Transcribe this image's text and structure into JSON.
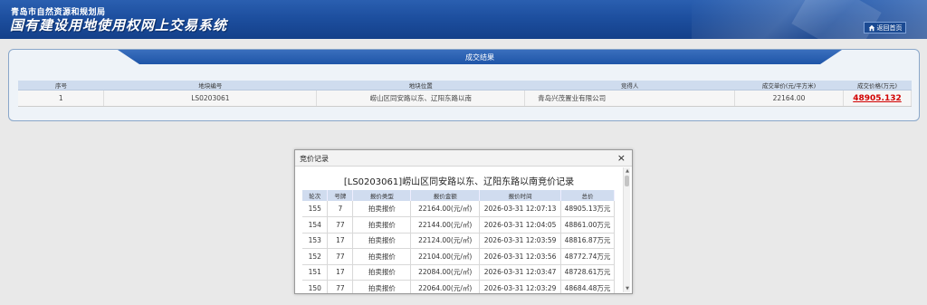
{
  "header": {
    "org_name": "青岛市自然资源和规划局",
    "system_title": "国有建设用地使用权网上交易系统",
    "back_label": "返回首页"
  },
  "result_panel": {
    "title": "成交结果",
    "columns": [
      "序号",
      "地块编号",
      "地块位置",
      "竞得人",
      "成交单价(元/平方米)",
      "成交价格(万元)"
    ],
    "row": {
      "index": "1",
      "parcel_no": "LS0203061",
      "location": "崂山区同安路以东、辽阳东路以南",
      "winner": "青岛兴茂置业有限公司",
      "unit_price": "22164.00",
      "total_price": "48905.132"
    }
  },
  "bid_dialog": {
    "title": "竞价记录",
    "close_symbol": "×",
    "heading": "[LS0203061]崂山区同安路以东、辽阳东路以南竞价记录",
    "columns": [
      "轮次",
      "号牌",
      "报价类型",
      "报价金额",
      "报价时间",
      "总价"
    ],
    "rows": [
      [
        "155",
        "7",
        "拍卖报价",
        "22164.00(元/㎡)",
        "2026-03-31 12:07:13",
        "48905.13万元"
      ],
      [
        "154",
        "77",
        "拍卖报价",
        "22144.00(元/㎡)",
        "2026-03-31 12:04:05",
        "48861.00万元"
      ],
      [
        "153",
        "17",
        "拍卖报价",
        "22124.00(元/㎡)",
        "2026-03-31 12:03:59",
        "48816.87万元"
      ],
      [
        "152",
        "77",
        "拍卖报价",
        "22104.00(元/㎡)",
        "2026-03-31 12:03:56",
        "48772.74万元"
      ],
      [
        "151",
        "17",
        "拍卖报价",
        "22084.00(元/㎡)",
        "2026-03-31 12:03:47",
        "48728.61万元"
      ],
      [
        "150",
        "77",
        "拍卖报价",
        "22064.00(元/㎡)",
        "2026-03-31 12:03:29",
        "48684.48万元"
      ]
    ]
  },
  "colors": {
    "header_blue": "#1d4f9f",
    "price_red": "#d20000",
    "table_header": "#cfdcee"
  }
}
